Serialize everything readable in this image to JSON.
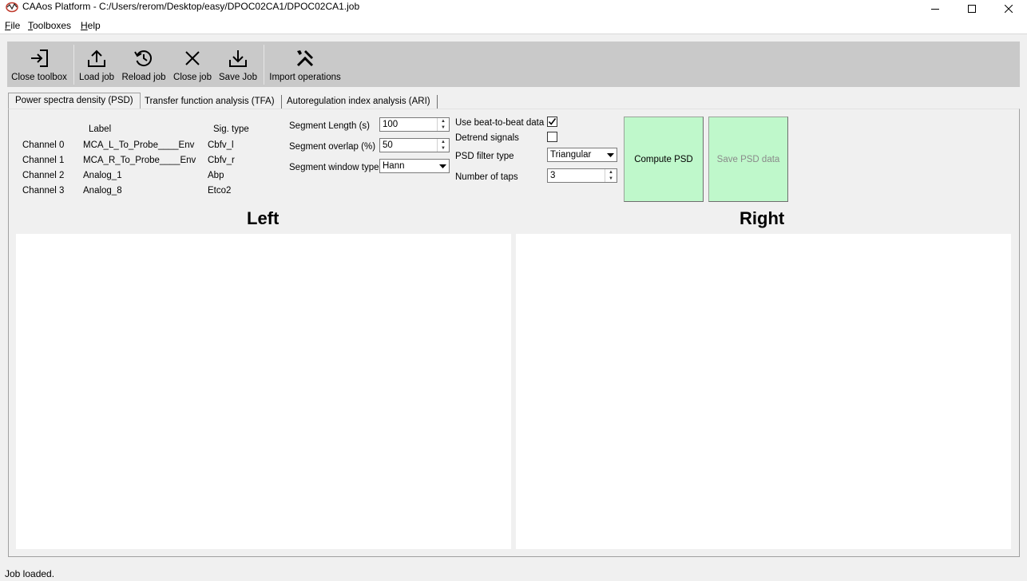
{
  "window": {
    "title": "CAAos Platform - C:/Users/rerom/Desktop/easy/DPOC02CA1/DPOC02CA1.job"
  },
  "menu": [
    {
      "label": "File",
      "mnemonic": "F",
      "rest": "ile"
    },
    {
      "label": "Toolboxes",
      "mnemonic": "T",
      "rest": "oolboxes"
    },
    {
      "label": "Help",
      "mnemonic": "H",
      "rest": "elp"
    }
  ],
  "toolbar": {
    "close_toolbox": "Close toolbox",
    "load_job": "Load job",
    "reload_job": "Reload job",
    "close_job": "Close job",
    "save_job": "Save Job",
    "import_operations": "Import operations"
  },
  "tabs": [
    {
      "label": "Power spectra density (PSD)",
      "active": true
    },
    {
      "label": "Transfer function analysis (TFA)",
      "active": false
    },
    {
      "label": "Autoregulation index analysis (ARI)",
      "active": false
    }
  ],
  "channels": {
    "header_label": "Label",
    "header_sigtype": "Sig. type",
    "rows": [
      {
        "channel": "Channel 0",
        "label": "MCA_L_To_Probe____Env",
        "sig_type": "Cbfv_l"
      },
      {
        "channel": "Channel 1",
        "label": "MCA_R_To_Probe____Env",
        "sig_type": "Cbfv_r"
      },
      {
        "channel": "Channel 2",
        "label": "Analog_1",
        "sig_type": "Abp"
      },
      {
        "channel": "Channel 3",
        "label": "Analog_8",
        "sig_type": "Etco2"
      }
    ]
  },
  "settings": {
    "segment_length_label": "Segment Length (s)",
    "segment_length_value": "100",
    "segment_overlap_label": "Segment overlap (%)",
    "segment_overlap_value": "50",
    "segment_window_label": "Segment window type",
    "segment_window_value": "Hann",
    "beat_to_beat_label": "Use beat-to-beat data",
    "beat_to_beat_checked": true,
    "detrend_label": "Detrend signals",
    "detrend_checked": false,
    "psd_filter_label": "PSD filter type",
    "psd_filter_value": "Triangular",
    "num_taps_label": "Number of taps",
    "num_taps_value": "3"
  },
  "buttons": {
    "compute_psd": "Compute PSD",
    "save_psd": "Save PSD data"
  },
  "plots": {
    "left_title": "Left",
    "right_title": "Right"
  },
  "status": {
    "text": "Job loaded."
  }
}
